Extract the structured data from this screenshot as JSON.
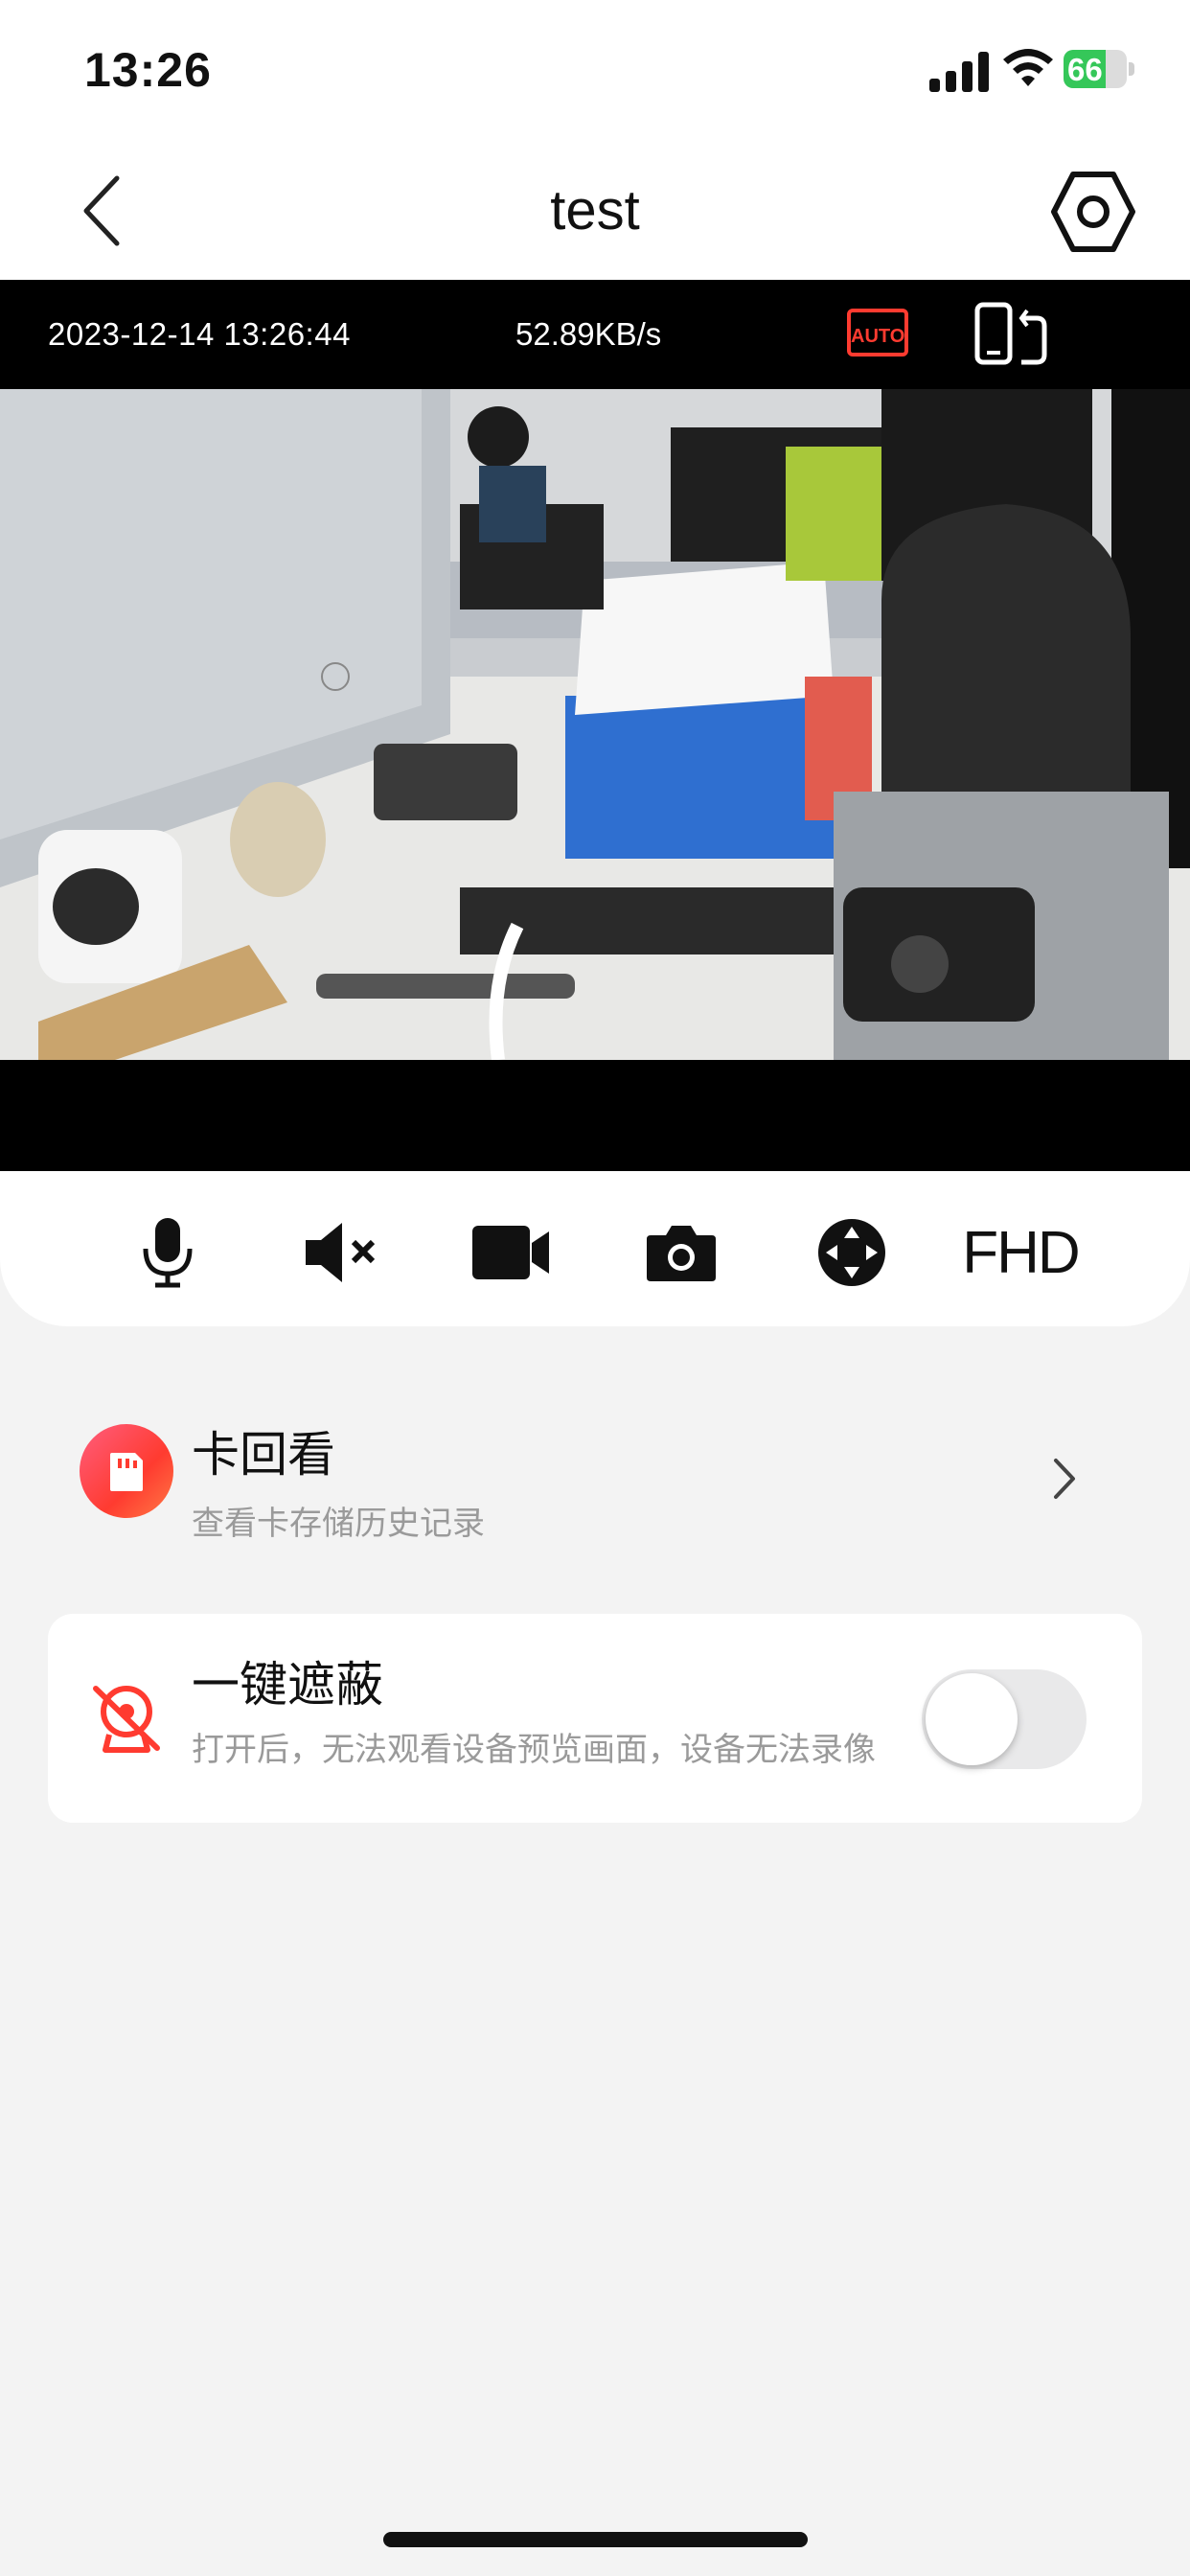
{
  "status_bar": {
    "time": "13:26",
    "battery_level": "66",
    "battery_fraction": 0.66
  },
  "header": {
    "title": "test",
    "back_icon": "chevron-left-icon",
    "settings_icon": "hexagon-gear-icon"
  },
  "video": {
    "timestamp": "2023-12-14 13:26:44",
    "bitrate": "52.89KB/s",
    "auto_label": "AUTO",
    "rotate_icon": "rotate-screen-icon"
  },
  "controls": {
    "items": [
      "mic-icon",
      "mute-speaker-icon",
      "record-video-icon",
      "camera-snapshot-icon",
      "ptz-direction-icon"
    ],
    "quality_label": "FHD"
  },
  "playback": {
    "title": "卡回看",
    "subtitle": "查看卡存储历史记录",
    "icon": "sd-card-icon",
    "accent": "#ff3b30"
  },
  "privacy": {
    "title": "一键遮蔽",
    "subtitle": "打开后，无法观看设备预览画面，设备无法录像",
    "icon": "camera-off-icon",
    "enabled": false
  },
  "colors": {
    "accent_red": "#ff3b30",
    "battery_green": "#35c759",
    "background": "#f3f3f3"
  }
}
